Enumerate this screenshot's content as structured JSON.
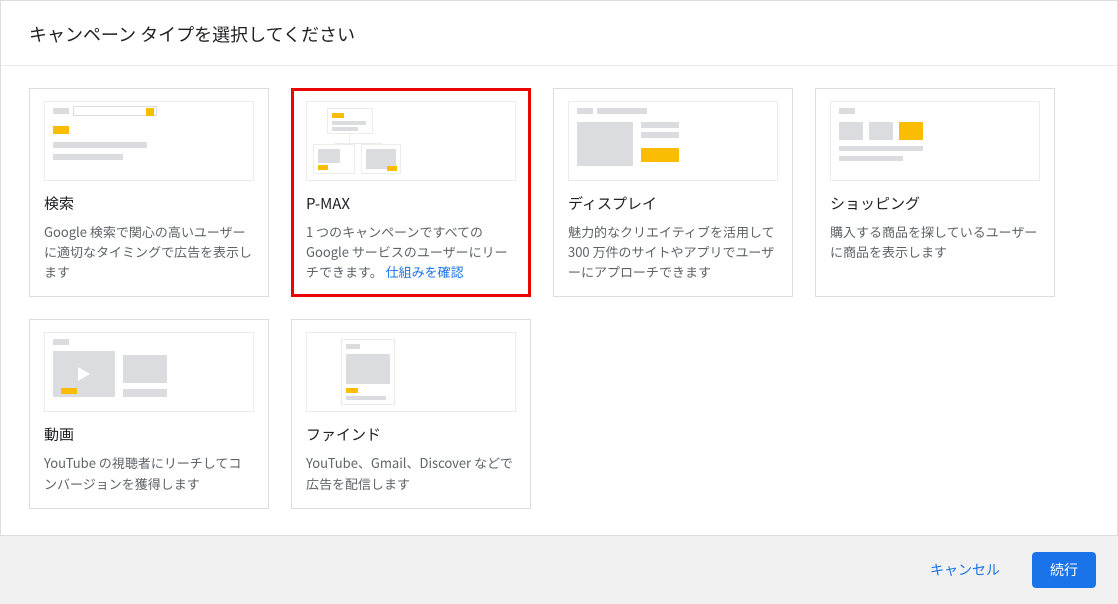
{
  "header": {
    "title": "キャンペーン タイプを選択してください"
  },
  "cards": {
    "search": {
      "title": "検索",
      "desc": "Google 検索で関心の高いユーザーに適切なタイミングで広告を表示します"
    },
    "pmax": {
      "title": "P-MAX",
      "desc_pre": "1 つのキャンペーンですべての Google サービスのユーザーにリーチできます。 ",
      "link": "仕組みを確認"
    },
    "display": {
      "title": "ディスプレイ",
      "desc": "魅力的なクリエイティブを活用して 300 万件のサイトやアプリでユーザーにアプローチできます"
    },
    "shopping": {
      "title": "ショッピング",
      "desc": "購入する商品を探しているユーザーに商品を表示します"
    },
    "video": {
      "title": "動画",
      "desc": "YouTube の視聴者にリーチしてコンバージョンを獲得します"
    },
    "find": {
      "title": "ファインド",
      "desc": "YouTube、Gmail、Discover などで広告を配信します"
    }
  },
  "actions": {
    "cancel": "キャンセル",
    "continue": "続行"
  }
}
